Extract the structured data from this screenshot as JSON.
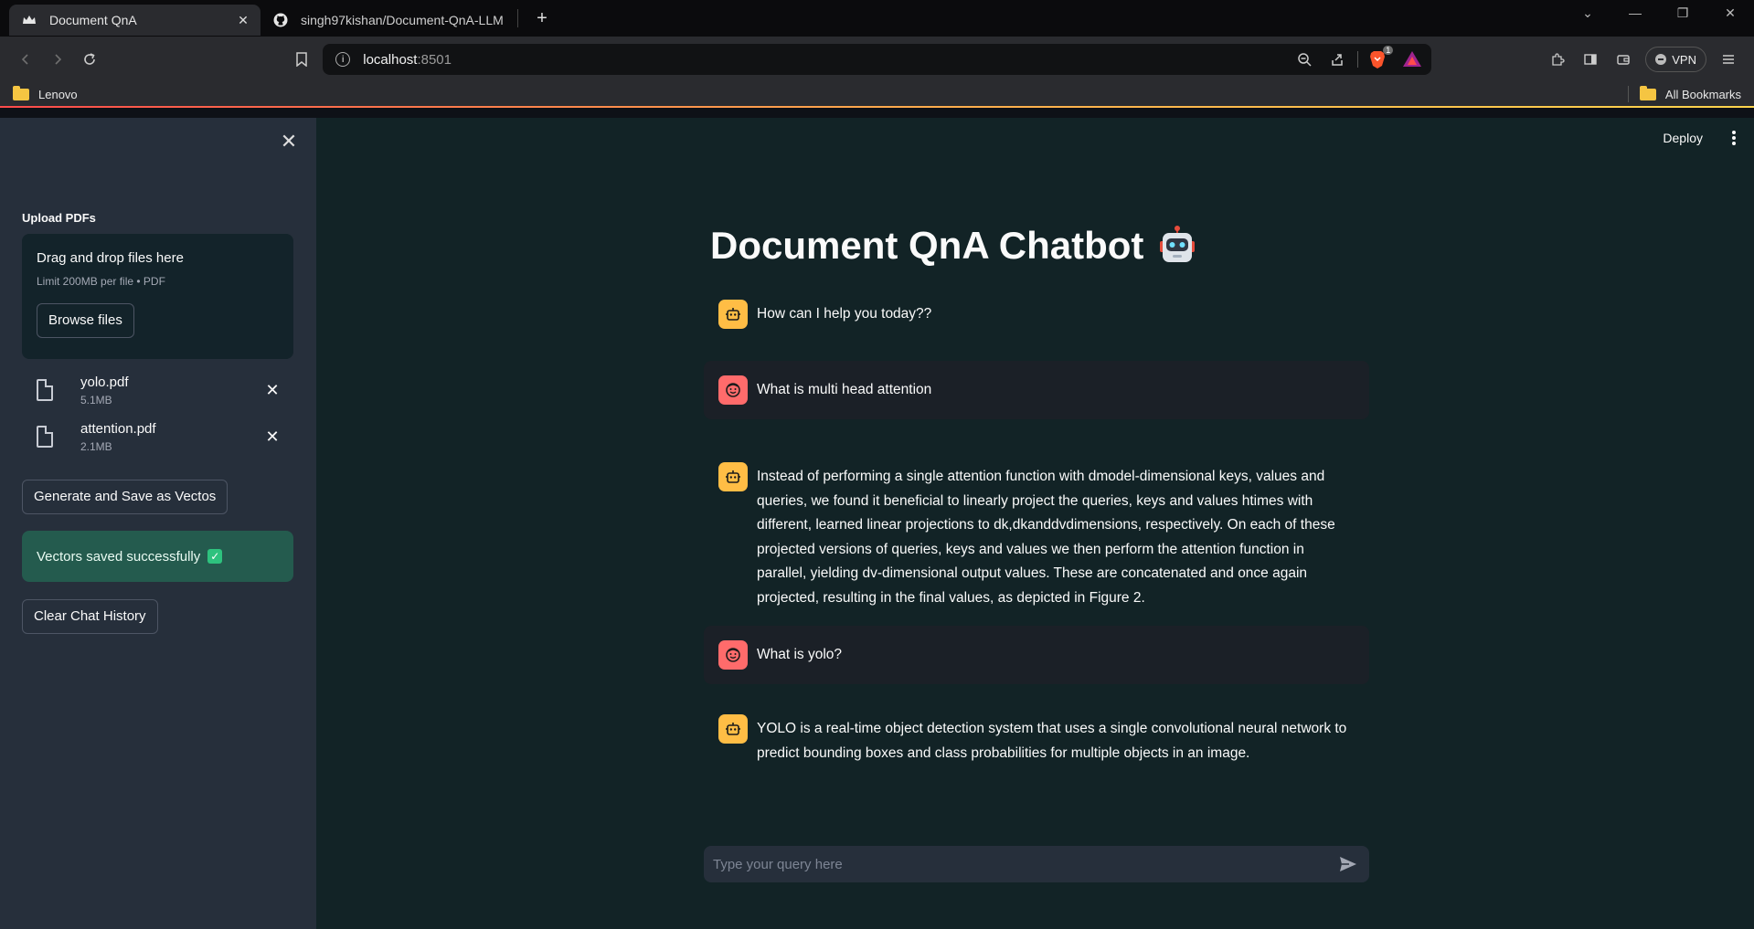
{
  "browser": {
    "tabs": [
      {
        "title": "Document QnA",
        "active": true
      },
      {
        "title": "singh97kishan/Document-QnA-LLM",
        "active": false
      }
    ],
    "url_host": "localhost",
    "url_port": ":8501",
    "brave_badge": "1",
    "vpn_label": "VPN",
    "bookmark_left": "Lenovo",
    "bookmark_right": "All Bookmarks"
  },
  "sidebar": {
    "upload_label": "Upload PDFs",
    "dropzone_title": "Drag and drop files here",
    "dropzone_limit": "Limit 200MB per file • PDF",
    "browse_label": "Browse files",
    "files": [
      {
        "name": "yolo.pdf",
        "size": "5.1MB"
      },
      {
        "name": "attention.pdf",
        "size": "2.1MB"
      }
    ],
    "generate_label": "Generate and Save as Vectos",
    "success_message": "Vectors saved successfully",
    "clear_label": "Clear Chat History"
  },
  "header": {
    "deploy_label": "Deploy"
  },
  "main": {
    "title": "Document QnA Chatbot",
    "messages": [
      {
        "role": "assistant",
        "text": "How can I help you today??"
      },
      {
        "role": "user",
        "text": "What is multi head attention"
      },
      {
        "role": "assistant",
        "text": "Instead of performing a single attention function with dmodel-dimensional keys, values and queries, we found it beneficial to linearly project the queries, keys and values htimes with different, learned linear projections to dk,dkanddvdimensions, respectively. On each of these projected versions of queries, keys and values we then perform the attention function in parallel, yielding dv-dimensional output values. These are concatenated and once again projected, resulting in the final values, as depicted in Figure 2."
      },
      {
        "role": "user",
        "text": "What is yolo?"
      },
      {
        "role": "assistant",
        "text": "YOLO is a real-time object detection system that uses a single convolutional neural network to predict bounding boxes and class probabilities for multiple objects in an image."
      }
    ],
    "input_placeholder": "Type your query here"
  },
  "colors": {
    "sidebar_bg": "#262f3b",
    "main_bg": "#122326",
    "bot_avatar": "#ffbd45",
    "user_avatar": "#ff6b6b",
    "success_bg": "#245b4e"
  }
}
